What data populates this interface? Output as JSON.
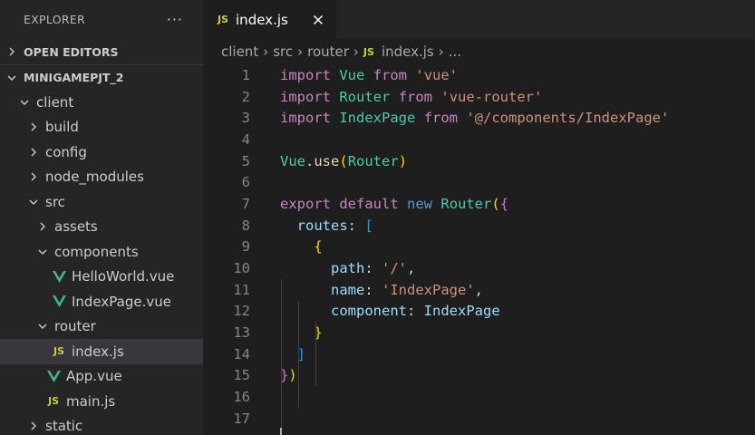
{
  "explorer": {
    "title": "EXPLORER",
    "more": "···",
    "open_editors": "OPEN EDITORS",
    "project": "MINIGAMEPJT_2",
    "tree": [
      {
        "label": "client",
        "kind": "folder",
        "open": true,
        "depth": 1
      },
      {
        "label": "build",
        "kind": "folder",
        "open": false,
        "depth": 2
      },
      {
        "label": "config",
        "kind": "folder",
        "open": false,
        "depth": 2
      },
      {
        "label": "node_modules",
        "kind": "folder",
        "open": false,
        "depth": 2
      },
      {
        "label": "src",
        "kind": "folder",
        "open": true,
        "depth": 2
      },
      {
        "label": "assets",
        "kind": "folder",
        "open": false,
        "depth": 3
      },
      {
        "label": "components",
        "kind": "folder",
        "open": true,
        "depth": 3
      },
      {
        "label": "HelloWorld.vue",
        "kind": "vue",
        "depth": 4
      },
      {
        "label": "IndexPage.vue",
        "kind": "vue",
        "depth": 4
      },
      {
        "label": "router",
        "kind": "folder",
        "open": true,
        "depth": 3
      },
      {
        "label": "index.js",
        "kind": "js",
        "depth": 4,
        "selected": true
      },
      {
        "label": "App.vue",
        "kind": "vue",
        "depth": 3
      },
      {
        "label": "main.js",
        "kind": "js",
        "depth": 3
      },
      {
        "label": "static",
        "kind": "folder",
        "open": false,
        "depth": 2
      }
    ]
  },
  "tab": {
    "icon_label": "JS",
    "label": "index.js",
    "close": "close-icon"
  },
  "breadcrumb": {
    "parts": [
      "client",
      "src",
      "router"
    ],
    "file_icon": "JS",
    "file": "index.js",
    "tail": "..."
  },
  "code": {
    "line_numbers": [
      "1",
      "2",
      "3",
      "4",
      "5",
      "6",
      "7",
      "8",
      "9",
      "10",
      "11",
      "12",
      "13",
      "14",
      "15",
      "16",
      "17"
    ],
    "lines": [
      [
        [
          "kw",
          "import"
        ],
        [
          "punc",
          " "
        ],
        [
          "cls",
          "Vue"
        ],
        [
          "punc",
          " "
        ],
        [
          "kw",
          "from"
        ],
        [
          "punc",
          " "
        ],
        [
          "str",
          "'vue'"
        ]
      ],
      [
        [
          "kw",
          "import"
        ],
        [
          "punc",
          " "
        ],
        [
          "cls",
          "Router"
        ],
        [
          "punc",
          " "
        ],
        [
          "kw",
          "from"
        ],
        [
          "punc",
          " "
        ],
        [
          "str",
          "'vue-router'"
        ]
      ],
      [
        [
          "kw",
          "import"
        ],
        [
          "punc",
          " "
        ],
        [
          "cls",
          "IndexPage"
        ],
        [
          "punc",
          " "
        ],
        [
          "kw",
          "from"
        ],
        [
          "punc",
          " "
        ],
        [
          "str",
          "'@/components/IndexPage'"
        ]
      ],
      [],
      [
        [
          "cls",
          "Vue"
        ],
        [
          "punc",
          "."
        ],
        [
          "fn",
          "use"
        ],
        [
          "b1",
          "("
        ],
        [
          "cls",
          "Router"
        ],
        [
          "b1",
          ")"
        ]
      ],
      [],
      [
        [
          "kw",
          "export"
        ],
        [
          "punc",
          " "
        ],
        [
          "kw",
          "default"
        ],
        [
          "punc",
          " "
        ],
        [
          "blue",
          "new"
        ],
        [
          "punc",
          " "
        ],
        [
          "cls",
          "Router"
        ],
        [
          "b1",
          "("
        ],
        [
          "b2",
          "{"
        ]
      ],
      [
        [
          "punc",
          "  "
        ],
        [
          "prop",
          "routes"
        ],
        [
          "punc",
          ": "
        ],
        [
          "b3",
          "["
        ]
      ],
      [
        [
          "punc",
          "    "
        ],
        [
          "b1",
          "{"
        ]
      ],
      [
        [
          "punc",
          "      "
        ],
        [
          "prop",
          "path"
        ],
        [
          "punc",
          ": "
        ],
        [
          "str",
          "'/'"
        ],
        [
          "punc",
          ","
        ]
      ],
      [
        [
          "punc",
          "      "
        ],
        [
          "prop",
          "name"
        ],
        [
          "punc",
          ": "
        ],
        [
          "str",
          "'IndexPage'"
        ],
        [
          "punc",
          ","
        ]
      ],
      [
        [
          "punc",
          "      "
        ],
        [
          "prop",
          "component"
        ],
        [
          "punc",
          ": "
        ],
        [
          "prop",
          "IndexPage"
        ]
      ],
      [
        [
          "punc",
          "    "
        ],
        [
          "b1",
          "}"
        ]
      ],
      [
        [
          "punc",
          "  "
        ],
        [
          "b3",
          "]"
        ]
      ],
      [
        [
          "b2",
          "}"
        ],
        [
          "b1",
          ")"
        ]
      ],
      [],
      []
    ]
  }
}
